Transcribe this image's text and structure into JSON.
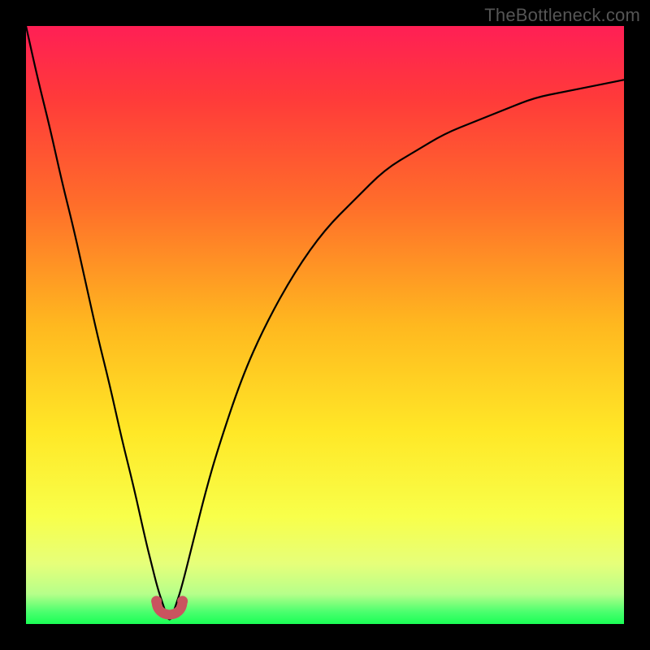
{
  "watermark": {
    "text": "TheBottleneck.com"
  },
  "chart_data": {
    "type": "line",
    "title": "",
    "xlabel": "",
    "ylabel": "",
    "xlim": [
      0,
      100
    ],
    "ylim": [
      0,
      100
    ],
    "x": [
      0,
      2,
      4,
      6,
      8,
      10,
      12,
      14,
      16,
      18,
      20,
      21,
      22,
      23,
      24,
      25,
      26,
      28,
      30,
      32,
      36,
      40,
      45,
      50,
      55,
      60,
      65,
      70,
      75,
      80,
      85,
      90,
      95,
      100
    ],
    "values": [
      100,
      91,
      83,
      74,
      66,
      57,
      48,
      40,
      31,
      23,
      14,
      10,
      6,
      3,
      0,
      3,
      6,
      14,
      22,
      29,
      41,
      50,
      59,
      66,
      71,
      76,
      79,
      82,
      84,
      86,
      88,
      89,
      90,
      91
    ],
    "notch_x": 24,
    "green_band_top": 97,
    "green_band_bottom": 100,
    "gradient_stops": [
      {
        "pos": 0,
        "color": "#ff1f55"
      },
      {
        "pos": 12,
        "color": "#ff3a3a"
      },
      {
        "pos": 30,
        "color": "#ff6e2a"
      },
      {
        "pos": 50,
        "color": "#ffb81f"
      },
      {
        "pos": 68,
        "color": "#ffe827"
      },
      {
        "pos": 82,
        "color": "#f8ff4a"
      },
      {
        "pos": 90,
        "color": "#e6ff7a"
      },
      {
        "pos": 95,
        "color": "#b6ff8a"
      },
      {
        "pos": 98,
        "color": "#4aff6e"
      },
      {
        "pos": 100,
        "color": "#1aff55"
      }
    ]
  }
}
